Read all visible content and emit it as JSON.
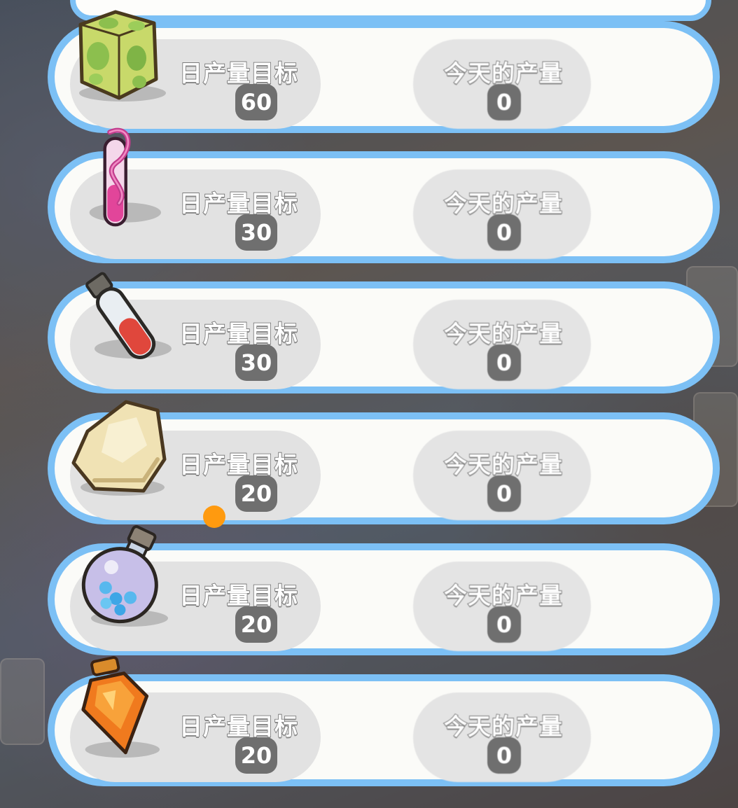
{
  "colors": {
    "panel_border": "#7cc0f5",
    "panel_fill": "#fbfbf8",
    "pill_fill": "#e2e2e2",
    "badge_fill": "#6f6f6f",
    "touch_indicator": "#ff9a0f"
  },
  "rows": [
    {
      "item_icon": "green-cube-icon",
      "target_label": "日产量目标",
      "target_value": "60",
      "today_label": "今天的产量",
      "today_value": "0"
    },
    {
      "item_icon": "pink-test-tube-icon",
      "target_label": "日产量目标",
      "target_value": "30",
      "today_label": "今天的产量",
      "today_value": "0"
    },
    {
      "item_icon": "red-vial-icon",
      "target_label": "日产量目标",
      "target_value": "30",
      "today_label": "今天的产量",
      "today_value": "0"
    },
    {
      "item_icon": "cream-stone-icon",
      "target_label": "日产量目标",
      "target_value": "20",
      "today_label": "今天的产量",
      "today_value": "0"
    },
    {
      "item_icon": "blue-bubble-flask-icon",
      "target_label": "日产量目标",
      "target_value": "20",
      "today_label": "今天的产量",
      "today_value": "0"
    },
    {
      "item_icon": "orange-potion-bottle-icon",
      "target_label": "日产量目标",
      "target_value": "20",
      "today_label": "今天的产量",
      "today_value": "0"
    }
  ]
}
